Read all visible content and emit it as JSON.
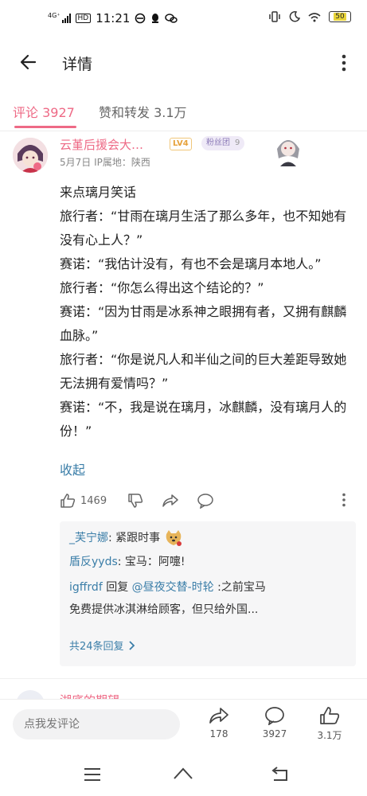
{
  "status_bar": {
    "network": "4G⁺",
    "hd": "HD",
    "time": "11:21",
    "battery": "50"
  },
  "app_bar": {
    "title": "详情"
  },
  "tabs": [
    {
      "label": "评论 3927"
    },
    {
      "label": "赞和转发 3.1万"
    }
  ],
  "comment": {
    "user_name": "云堇后援会大…",
    "level": "LV4",
    "fan_badge": "粉丝团",
    "fan_level": "9",
    "meta": "5月7日  IP属地：陕西",
    "content": [
      "来点璃月笑话",
      "旅行者：“甘雨在璃月生活了那么多年，也不知她有没有心上人？”",
      "赛诺：“我估计没有，有也不会是璃月本地人。”",
      "旅行者：“你怎么得出这个结论的？”",
      "赛诺：“因为甘雨是冰系神之眼拥有者，又拥有麒麟血脉。”",
      "旅行者：“你是说凡人和半仙之间的巨大差距导致她无法拥有爱情吗？”",
      "赛诺：“不，我是说在璃月，冰麒麟，没有璃月人的份！”"
    ],
    "collapse_label": "收起",
    "like_count": "1469"
  },
  "replies": {
    "r1_user": "_芙宁娜",
    "r1_text": ": 紧跟时事",
    "r2_user": "盾反yyds",
    "r2_text": ": 宝马：阿嚏!",
    "r3_user": "igffrdf",
    "r3_mid": " 回复 ",
    "r3_target": "@昼夜交替-时轮",
    "r3_text": " :之前宝马",
    "r3_text2": "免费提供冰淇淋给顾客，但只给外国...",
    "more_label": "共24条回复"
  },
  "next_comment": {
    "user_name": "湖底的期望"
  },
  "bottom_bar": {
    "input_placeholder": "点我发评论",
    "share_count": "178",
    "comment_count": "3927",
    "like_count": "3.1万"
  },
  "colors": {
    "accent": "#ee6a86",
    "link": "#3b7ea8",
    "level": "#e6a23c"
  }
}
